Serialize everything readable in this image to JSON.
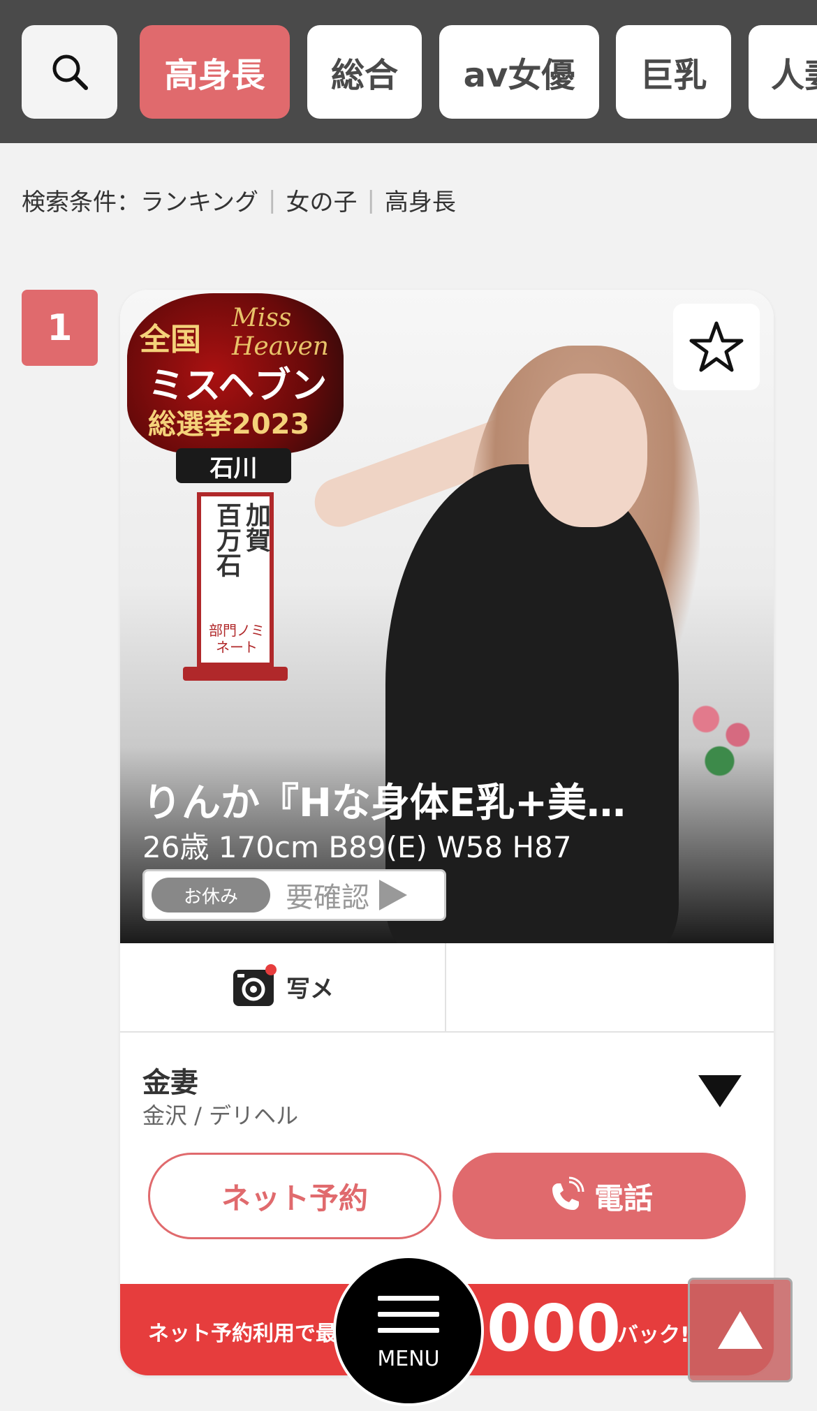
{
  "filters": {
    "items": [
      {
        "label": "高身長",
        "active": true
      },
      {
        "label": "総合",
        "active": false
      },
      {
        "label": "av女優",
        "active": false
      },
      {
        "label": "巨乳",
        "active": false
      },
      {
        "label": "人妻",
        "active": false
      }
    ]
  },
  "breadcrumb": {
    "items": [
      "検索条件：ランキング",
      "女の子",
      "高身長"
    ]
  },
  "ranking": {
    "rank": "1"
  },
  "card": {
    "award": {
      "line1": "全国",
      "line2": "Miss Heaven",
      "line3": "ミスヘブン",
      "line4": "総選挙2023",
      "prefecture": "石川",
      "division_a": "加賀",
      "division_b": "百万石",
      "nomination": "部門ノミネート"
    },
    "name": "りんか『Hな身体E乳+美…",
    "specs": "26歳 170cm B89(E) W58 H87",
    "status_pill": "お休み",
    "status_text": "要確認",
    "photo_tab_label": "写メ",
    "shop_name": "金妻",
    "shop_area": "金沢 / デリヘル",
    "reserve_label": "ネット予約",
    "call_label": "電話",
    "promo_prefix": "ネット予約利用で最",
    "promo_amount": ",000",
    "promo_suffix": "バック!"
  },
  "menu": {
    "label": "MENU"
  },
  "colors": {
    "accent": "#e06a6d",
    "topbar": "#4a4a4a",
    "promo": "#e63d3d"
  }
}
